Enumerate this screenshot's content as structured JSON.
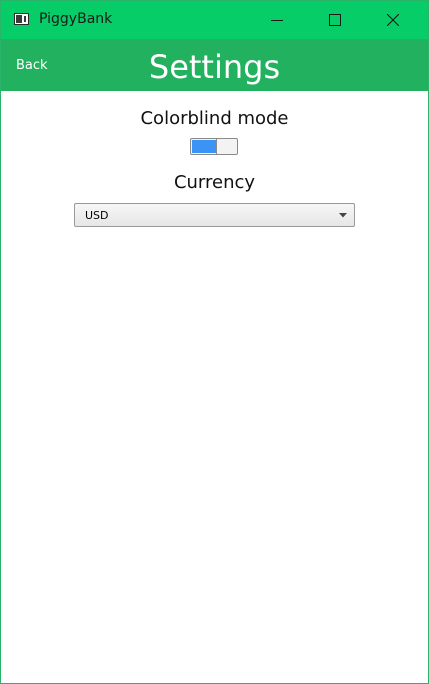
{
  "window": {
    "title": "PiggyBank",
    "icons": {
      "app": "piggybank-app-icon",
      "minimize": "minimize-icon",
      "maximize": "maximize-icon",
      "close": "close-icon"
    },
    "colors": {
      "titlebar": "#06cd68",
      "header": "#22b15f"
    }
  },
  "header": {
    "back_label": "Back",
    "title": "Settings"
  },
  "settings": {
    "colorblind_label": "Colorblind mode",
    "colorblind_enabled": true,
    "toggle_color": "#3b94f5",
    "currency_label": "Currency",
    "currency_value": "USD",
    "currency_arrow_icon": "dropdown-arrow-icon"
  }
}
